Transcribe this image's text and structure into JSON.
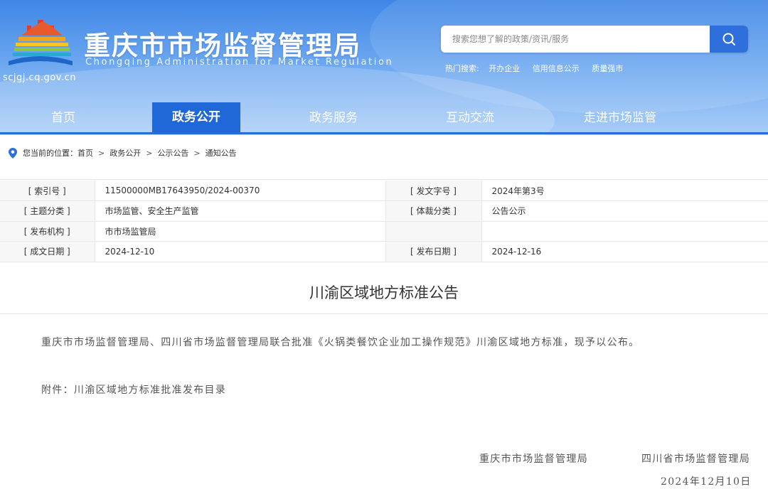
{
  "header": {
    "site_title": "重庆市市场监督管理局",
    "site_subtitle": "Chongqing  Administration for Market Regulation",
    "domain": "scjgj.cq.gov.cn",
    "search": {
      "placeholder": "搜索您想了解的政策/资讯/服务"
    },
    "hot_search": {
      "label": "热门搜索:",
      "links": [
        "开办企业",
        "信用信息公示",
        "质量强市"
      ]
    }
  },
  "nav": {
    "items": [
      {
        "label": "首页"
      },
      {
        "label": "政务公开"
      },
      {
        "label": "政务服务"
      },
      {
        "label": "互动交流"
      },
      {
        "label": "走进市场监管"
      }
    ],
    "active_index": 1
  },
  "breadcrumb": {
    "prefix": "您当前的位置：",
    "items": [
      "首页",
      "政务公开",
      "公示公告",
      "通知公告"
    ],
    "separator": ">"
  },
  "meta": {
    "rows": [
      {
        "label1": "[ 索引号 ]",
        "value1": "11500000MB17643950/2024-00370",
        "label2": "[ 发文字号 ]",
        "value2": "2024年第3号"
      },
      {
        "label1": "[ 主题分类 ]",
        "value1": "市场监管、安全生产监管",
        "label2": "[ 体裁分类 ]",
        "value2": "公告公示"
      },
      {
        "label1": "[ 发布机构 ]",
        "value1": "市市场监管局",
        "label2": "",
        "value2": ""
      },
      {
        "label1": "[ 成文日期 ]",
        "value1": "2024-12-10",
        "label2": "[ 发布日期 ]",
        "value2": "2024-12-16"
      }
    ]
  },
  "article": {
    "title": "川渝区域地方标准公告",
    "paragraph1": "重庆市市场监督管理局、四川省市场监督管理局联合批准《火锅类餐饮企业加工操作规范》川渝区域地方标准，现予以公布。",
    "attachment": "附件：川渝区域地方标准批准发布目录",
    "signature1": "重庆市市场监督管理局",
    "signature2": "四川省市场监督管理局",
    "date": "2024年12月10日"
  },
  "colors": {
    "header_top": "#3f86e6",
    "nav_active_bg": "#2067d8",
    "nav_active_underline": "#d42a2a",
    "search_button": "#2e6fdc"
  }
}
